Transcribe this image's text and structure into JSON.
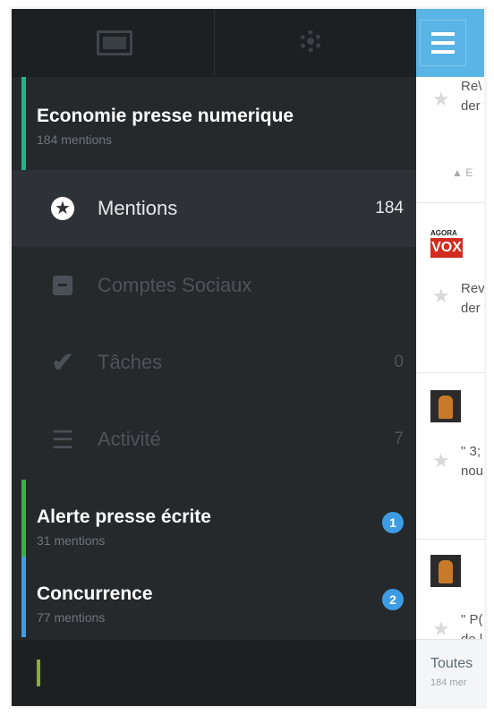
{
  "drawer": {
    "groups": [
      {
        "title": "Economie presse numerique",
        "subtitle": "184 mentions",
        "accent": "#1fb48a"
      },
      {
        "title": "Alerte presse écrite",
        "subtitle": "31 mentions",
        "accent": "#3cb043",
        "badge": "1"
      },
      {
        "title": "Concurrence",
        "subtitle": "77 mentions",
        "accent": "#3d9ce3",
        "badge": "2"
      }
    ],
    "nav": [
      {
        "label": "Mentions",
        "count": "184",
        "icon": "star-circle-icon",
        "active": true
      },
      {
        "label": "Comptes Sociaux",
        "count": "",
        "icon": "archive-box-icon",
        "active": false
      },
      {
        "label": "Tâches",
        "count": "0",
        "icon": "checkmark-icon",
        "active": false
      },
      {
        "label": "Activité",
        "count": "7",
        "icon": "list-icon",
        "active": false
      }
    ]
  },
  "content": {
    "cards": [
      {
        "line1": "Re\\",
        "line2": "der"
      },
      {
        "line1": "Rev",
        "line2": "der"
      },
      {
        "line1": "\" 3;",
        "line2": "nou"
      },
      {
        "line1": "\" P(",
        "line2": "de l"
      }
    ],
    "vox_top": "AGORA",
    "vox_bottom": "VOX",
    "caret_text": "▲ E",
    "footer_title": "Toutes",
    "footer_sub": "184 mer"
  },
  "colors": {
    "drawer_bg": "#25292c",
    "active_bg": "#2e3236",
    "hamburger_bg": "#5ab4e5",
    "badge_bg": "#3d9ce3"
  }
}
